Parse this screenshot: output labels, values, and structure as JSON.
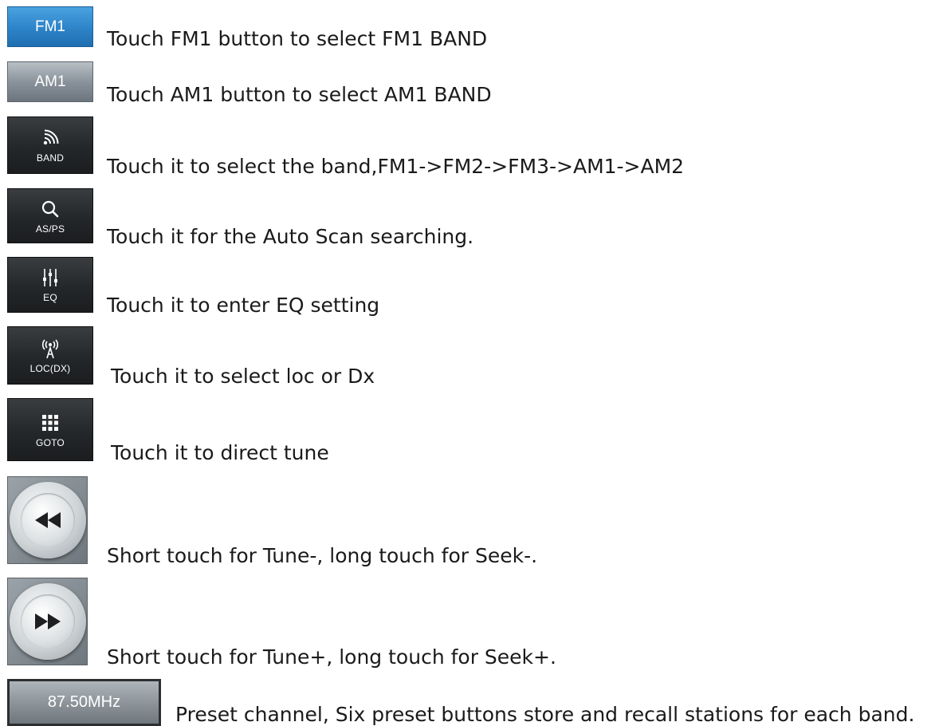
{
  "rows": [
    {
      "button_label": "FM1",
      "description": "Touch FM1 button to select FM1 BAND"
    },
    {
      "button_label": "AM1",
      "description": "Touch AM1 button to select AM1 BAND"
    },
    {
      "button_label": "BAND",
      "icon": "signal-icon",
      "description": "Touch it to select the band,FM1->FM2->FM3->AM1->AM2"
    },
    {
      "button_label": "AS/PS",
      "icon": "search-icon",
      "description": "Touch it for the Auto Scan searching."
    },
    {
      "button_label": "EQ",
      "icon": "equalizer-icon",
      "description": "Touch it to enter EQ setting"
    },
    {
      "button_label": "LOC(DX)",
      "icon": "antenna-icon",
      "description": "Touch it to select loc or Dx"
    },
    {
      "button_label": "GOTO",
      "icon": "keypad-icon",
      "description": "Touch it to direct tune"
    },
    {
      "icon": "rewind-icon",
      "description": "Short touch for Tune-, long touch for Seek-."
    },
    {
      "icon": "fast-forward-icon",
      "description": "Short touch for Tune+, long touch for Seek+."
    },
    {
      "button_label": "87.50MHz",
      "description": "Preset channel, Six preset buttons store and recall stations for each band."
    }
  ],
  "colors": {
    "active_blue": "#2f86cb",
    "grey_button": "#8a939b",
    "dark_button": "#24272a",
    "text": "#1a1a1a"
  }
}
